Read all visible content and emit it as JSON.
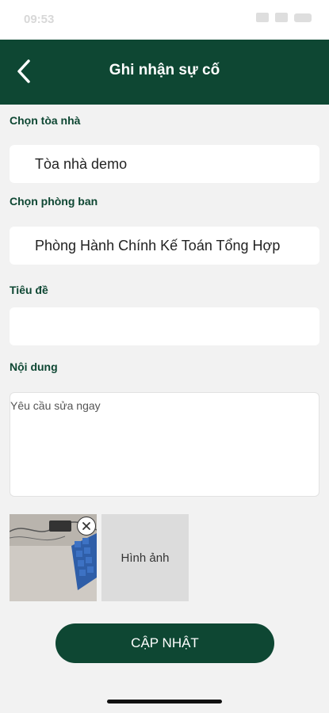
{
  "status_bar": {
    "time": "09:53"
  },
  "header": {
    "title": "Ghi nhận sự cố",
    "back_icon": "chevron-left-icon"
  },
  "form": {
    "building": {
      "label": "Chọn tòa nhà",
      "value": "Tòa nhà demo"
    },
    "department": {
      "label": "Chọn phòng ban",
      "value": "Phòng Hành Chính Kế Toán Tổng Hợp"
    },
    "title_field": {
      "label": "Tiêu đề",
      "value": ""
    },
    "content": {
      "label": "Nội dung",
      "value": "Yêu cầu sửa ngay"
    }
  },
  "images": {
    "add_label": "Hình ảnh",
    "remove_icon": "close-icon"
  },
  "actions": {
    "update_label": "CẬP NHẬT"
  },
  "colors": {
    "primary": "#0e4733",
    "background": "#f2f2f2"
  }
}
